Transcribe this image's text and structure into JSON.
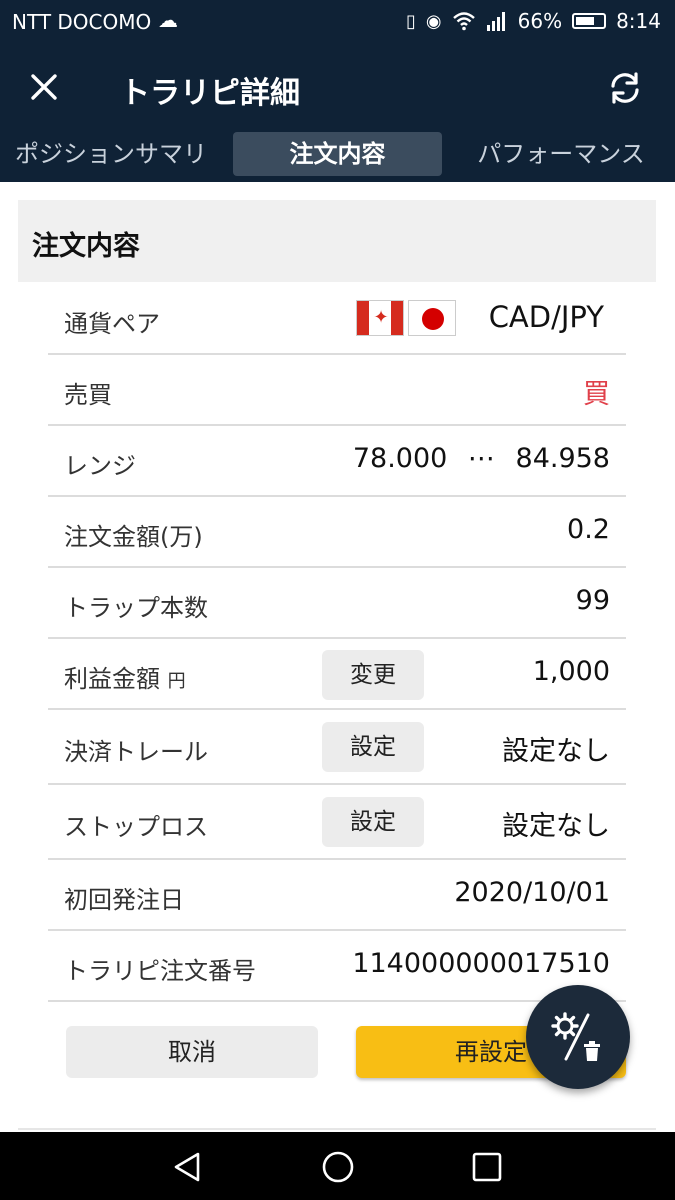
{
  "status_bar": {
    "carrier": "NTT DOCOMO",
    "battery": "66%",
    "time": "8:14"
  },
  "app_bar": {
    "title": "トラリピ詳細"
  },
  "tabs": [
    {
      "label": "ポジションサマリ",
      "active": false
    },
    {
      "label": "注文内容",
      "active": true
    },
    {
      "label": "パフォーマンス",
      "active": false
    }
  ],
  "section": {
    "title": "注文内容"
  },
  "rows": {
    "pair": {
      "label": "通貨ペア",
      "value": "CAD/JPY"
    },
    "side": {
      "label": "売買",
      "value": "買"
    },
    "range": {
      "label": "レンジ",
      "low": "78.000",
      "sep": "⋯",
      "high": "84.958"
    },
    "amount": {
      "label": "注文金額",
      "unit": "(万)",
      "value": "0.2"
    },
    "traps": {
      "label": "トラップ本数",
      "value": "99"
    },
    "profit": {
      "label": "利益金額",
      "unit": "円",
      "button": "変更",
      "value": "1,000"
    },
    "trail": {
      "label": "決済トレール",
      "button": "設定",
      "value": "設定なし"
    },
    "stoploss": {
      "label": "ストップロス",
      "button": "設定",
      "value": "設定なし"
    },
    "first_date": {
      "label": "初回発注日",
      "value": "2020/10/01"
    },
    "order_no": {
      "label": "トラリピ注文番号",
      "value": "1140000000175​10"
    }
  },
  "actions": {
    "cancel": "取消",
    "reset": "再設定"
  },
  "colors": {
    "header_bg": "#0f2236",
    "tab_active_bg": "#3b4c5e",
    "buy_red": "#e0404a",
    "reset_yellow": "#f8be14",
    "fab_bg": "#1c2a3a"
  }
}
